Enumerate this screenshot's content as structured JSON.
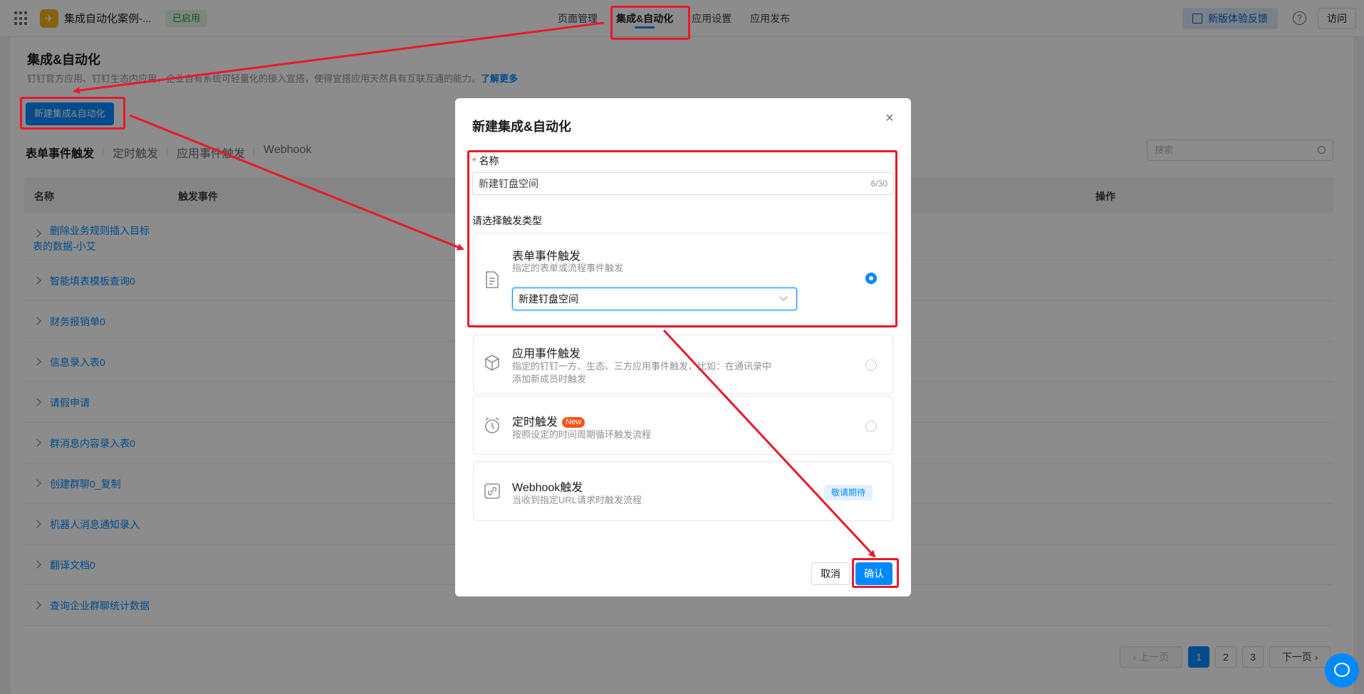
{
  "header": {
    "app_name": "集成自动化案例-...",
    "status": "已启用",
    "nav": [
      "页面管理",
      "集成&自动化",
      "应用设置",
      "应用发布"
    ],
    "feedback": "新版体验反馈",
    "help": "?",
    "visit": "访问"
  },
  "page": {
    "title": "集成&自动化",
    "desc": "钉钉官方应用、钉钉生态内应用、企业自有系统可轻量化的接入宜搭，使得宜搭应用天然具有互联互通的能力。",
    "learn_more": "了解更多",
    "new_button": "新建集成&自动化",
    "tabs": [
      "表单事件触发",
      "定时触发",
      "应用事件触发",
      "Webhook"
    ],
    "search_placeholder": "搜索",
    "columns": {
      "name": "名称",
      "trigger": "触发事件",
      "action": "操作"
    },
    "rows": [
      {
        "name_line1": "删除业务规则插入目标",
        "name_line2": "表的数据-小艾"
      },
      {
        "name_line1": "智能填表模板查询0"
      },
      {
        "name_line1": "财务报销单0"
      },
      {
        "name_line1": "信息录入表0"
      },
      {
        "name_line1": "请假申请"
      },
      {
        "name_line1": "群消息内容录入表0"
      },
      {
        "name_line1": "创建群聊0_复制"
      },
      {
        "name_line1": "机器人消息通知录入"
      },
      {
        "name_line1": "翻译文档0"
      },
      {
        "name_line1": "查询企业群聊统计数据"
      }
    ],
    "pagination": {
      "prev": "上一页",
      "pages": [
        "1",
        "2",
        "3"
      ],
      "current": "1",
      "next": "下一页"
    }
  },
  "modal": {
    "title": "新建集成&自动化",
    "close": "×",
    "name_label": "名称",
    "required_mark": "*",
    "name_value": "新建钉盘空间",
    "name_count": "6/30",
    "trigger_label": "请选择触发类型",
    "options": [
      {
        "title": "表单事件触发",
        "desc": "指定的表单或流程事件触发",
        "selected": true,
        "select_value": "新建钉盘空间",
        "icon": "document-icon"
      },
      {
        "title": "应用事件触发",
        "desc_line1": "指定的钉钉一方、生态、三方应用事件触发，比如：在通讯录中",
        "desc_line2": "添加新成员时触发",
        "selected": false,
        "icon": "cube-icon"
      },
      {
        "title": "定时触发",
        "tag": "New",
        "desc": "按照设定的时间周期循环触发流程",
        "selected": false,
        "icon": "alarm-clock-icon"
      },
      {
        "title": "Webhook触发",
        "desc": "当收到指定URL请求时触发流程",
        "badge": "敬请期待",
        "icon": "link-icon"
      }
    ],
    "cancel": "取消",
    "confirm": "确认"
  },
  "colors": {
    "accent": "#0089ff",
    "annotation": "#e8192c",
    "new_tag": "#ff5219"
  }
}
